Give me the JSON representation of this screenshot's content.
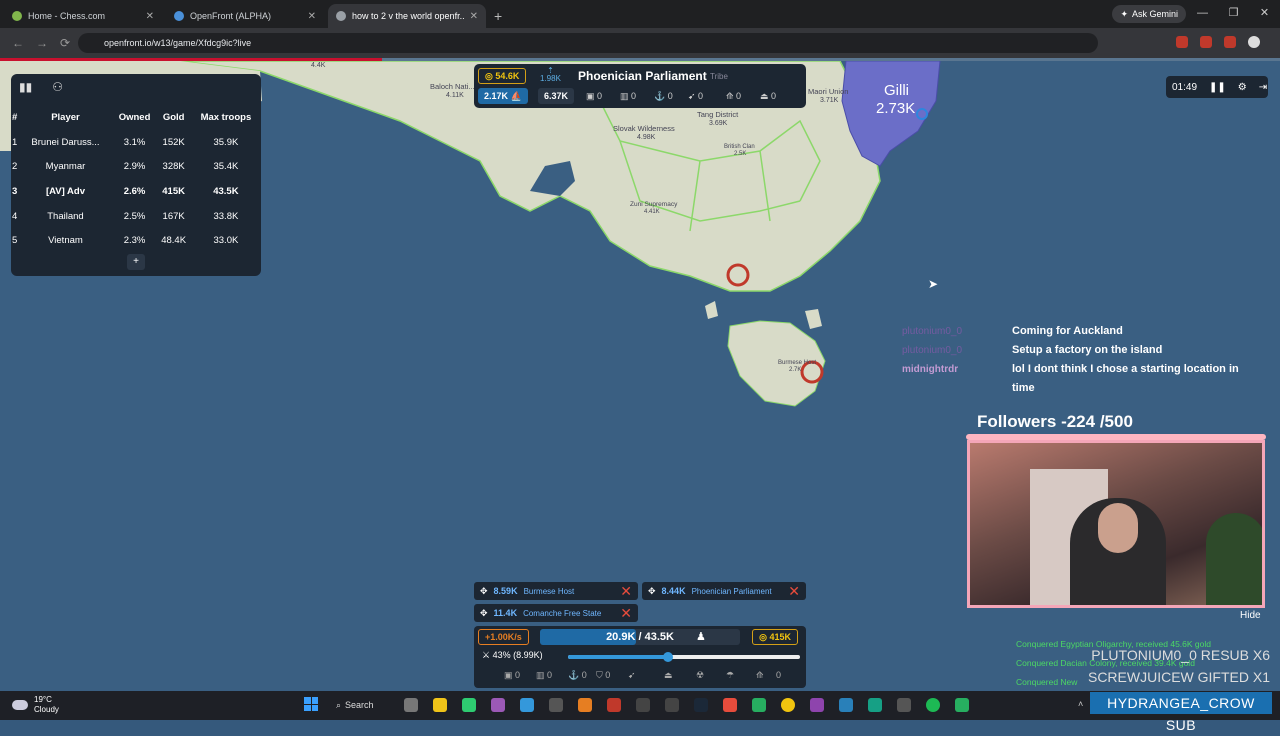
{
  "browser": {
    "tabs": [
      {
        "title": "Home - Chess.com",
        "active": false,
        "color": "#81b64c"
      },
      {
        "title": "OpenFront (ALPHA)",
        "active": false,
        "color": "#4a90d9"
      },
      {
        "title": "how to 2 v the world openfr...",
        "active": true,
        "color": "#9aa0a6"
      }
    ],
    "new_tab": "+",
    "gemini_label": "Ask Gemini",
    "url": "openfront.io/w13/game/Xfdcg9ic?live"
  },
  "leaderboard": {
    "headers": [
      "#",
      "Player",
      "Owned",
      "Gold",
      "Max troops"
    ],
    "rows": [
      {
        "rank": "1",
        "player": "Brunei Daruss...",
        "owned": "3.1%",
        "gold": "152K",
        "troops": "35.9K"
      },
      {
        "rank": "2",
        "player": "Myanmar",
        "owned": "2.9%",
        "gold": "328K",
        "troops": "35.4K"
      },
      {
        "rank": "3",
        "player": "[AV] Adv",
        "owned": "2.6%",
        "gold": "415K",
        "troops": "43.5K"
      },
      {
        "rank": "4",
        "player": "Thailand",
        "owned": "2.5%",
        "gold": "167K",
        "troops": "33.8K"
      },
      {
        "rank": "5",
        "player": "Vietnam",
        "owned": "2.3%",
        "gold": "48.4K",
        "troops": "33.0K"
      }
    ],
    "expand": "+"
  },
  "player_info": {
    "gold": "54.6K",
    "small_up": "1.98K",
    "name": "Phoenician Parliament",
    "type": "Tribe",
    "troops": "2.17K",
    "workers": "6.37K",
    "counts": [
      "0",
      "0",
      "0",
      "0",
      "0",
      "0"
    ]
  },
  "map": {
    "labels": [
      {
        "text": "Baloch Nati..."
      },
      {
        "text": "4.11K"
      },
      {
        "text": "Tang District"
      },
      {
        "text": "3.69K"
      },
      {
        "text": "Maori Union"
      },
      {
        "text": "3.71K"
      },
      {
        "text": "Slovak Wilderness"
      },
      {
        "text": "4.98K"
      },
      {
        "text": "British Clan"
      },
      {
        "text": "2.5K"
      },
      {
        "text": "Zuni Supremacy"
      },
      {
        "text": "4.41K"
      },
      {
        "text": "Burmese Host"
      },
      {
        "text": "2.7K"
      },
      {
        "text": "4.4K"
      }
    ],
    "gilli_name": "Gilli",
    "gilli_troops": "2.73K"
  },
  "timer": {
    "time": "01:49"
  },
  "chat": [
    {
      "user": "plutonium0_0",
      "msg": "Coming for Auckland"
    },
    {
      "user": "plutonium0_0",
      "msg": "Setup a factory on the island"
    },
    {
      "user": "midnightrdr",
      "msg": "lol I dont think I chose a starting location in"
    },
    {
      "user": "",
      "msg": "time"
    }
  ],
  "stream": {
    "followers": "Followers -224 /500",
    "hide": "Hide",
    "conquered": [
      "Conquered Egyptian Oligarchy, received 45.6K gold",
      "Conquered Dacian Colony, received 39.4K gold",
      "Conquered New"
    ],
    "subs": [
      "PLUTONIUM0_0  RESUB X6",
      "SCREWJUICEW  GIFTED X1"
    ],
    "hydra": "HYDRANGEA_CROW  SUB"
  },
  "attacks": [
    {
      "num": "8.59K",
      "name": "Burmese Host"
    },
    {
      "num": "8.44K",
      "name": "Phoenician Parliament"
    },
    {
      "num": "11.4K",
      "name": "Comanche Free State"
    }
  ],
  "controls": {
    "troop_rate": "+1.00K/s",
    "troops": "20.9K / 43.5K",
    "troop_fraction": 0.48,
    "gold": "415K",
    "attack_ratio": "43% (8.99K)",
    "slider_fraction": 0.43,
    "buildings": [
      "0",
      "0",
      "0",
      "0",
      "0"
    ]
  },
  "taskbar": {
    "temp": "19°C",
    "condition": "Cloudy",
    "search": "Search"
  },
  "colors": {
    "ocean": "#3a5f82",
    "land": "#d8dbc8",
    "border_green": "#8cd86a",
    "gilli": "#6b6ec8",
    "panel": "#1c2632"
  }
}
